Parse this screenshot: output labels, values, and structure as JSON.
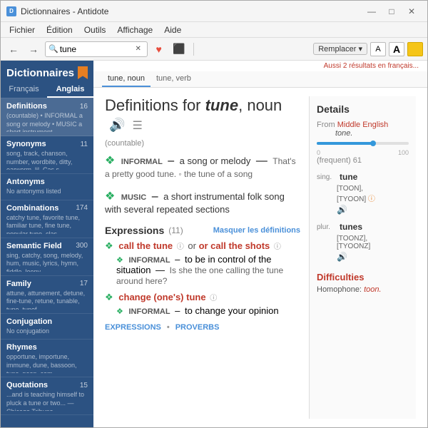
{
  "window": {
    "title": "Dictionnaires - Antidote",
    "icon_label": "D"
  },
  "menubar": {
    "items": [
      "Fichier",
      "Édition",
      "Outils",
      "Affichage",
      "Aide"
    ]
  },
  "toolbar": {
    "back_label": "←",
    "forward_label": "→",
    "search_value": "tune",
    "search_placeholder": "tune",
    "remplacer_label": "Remplacer ▾",
    "font_small_label": "A",
    "font_large_label": "A"
  },
  "also_results": "Aussi 2 résultats en français...",
  "sidebar": {
    "title": "Dictionnaires",
    "lang_tabs": [
      "Français",
      "Anglais"
    ],
    "active_lang": "Anglais",
    "sections": [
      {
        "id": "definitions",
        "title": "Definitions",
        "count": 16,
        "preview": "(countable) • INFORMAL a song or melody • MUSIC a short instrument..."
      },
      {
        "id": "synonyms",
        "title": "Synonyms",
        "count": 11,
        "preview": "song, track, chanson, number, wordbite, ditty, earworm, lil, Cas s..."
      },
      {
        "id": "antonyms",
        "title": "Antonyms",
        "count": "",
        "preview": "No antonyms listed"
      },
      {
        "id": "combinations",
        "title": "Combinations",
        "count": 174,
        "preview": "catchy tune, favorite tune, familiar tune, fine tune, popular tune, clas..."
      },
      {
        "id": "semantic",
        "title": "Semantic Field",
        "count": 300,
        "preview": "sing, catchy, song, melody, hum, music, lyrics, hymn, fiddle, loony..."
      },
      {
        "id": "family",
        "title": "Family",
        "count": 17,
        "preview": "attune, attunement, detune, fine-tune, retune, tunable, tune, tunef..."
      },
      {
        "id": "conjugation",
        "title": "Conjugation",
        "count": "",
        "preview": "No conjugation"
      },
      {
        "id": "rhymes",
        "title": "Rhymes",
        "count": "",
        "preview": "opportune, importune, immune, dune, bassoon, tune, peon, com..."
      },
      {
        "id": "quotations",
        "title": "Quotations",
        "count": 15,
        "preview": "...and is teaching himself to pluck a tune or two... — Chicago Tribune"
      }
    ]
  },
  "content": {
    "tabs": [
      {
        "id": "tune-noun",
        "label": "tune, noun"
      },
      {
        "id": "tune-verb",
        "label": "tune, verb"
      }
    ],
    "active_tab": "tune, noun",
    "definitions_heading": "Definitions for",
    "word": "tune",
    "pos": "noun",
    "countable_label": "(countable)",
    "definitions": [
      {
        "tag": "INFORMAL",
        "definition": "a song or melody",
        "example": "That's a pretty good tune. ◦ the tune of a song"
      },
      {
        "tag": "MUSIC",
        "definition": "a short instrumental folk song with several repeated sections",
        "example": ""
      }
    ],
    "expressions_heading": "Expressions",
    "expressions_count": "(11)",
    "masquer_label": "Masquer les définitions",
    "expressions": [
      {
        "phrase": "call the tune",
        "alt_phrase": "or call the shots",
        "tag": "INFORMAL",
        "definition": "to be in control of the situation",
        "example": "Is she the one calling the tune around here?"
      },
      {
        "phrase": "change (one's) tune",
        "tag": "INFORMAL",
        "definition": "to change your opinion",
        "example": ""
      }
    ],
    "bottom_links": [
      "EXPRESSIONS",
      "PROVERBS"
    ]
  },
  "details": {
    "title": "Details",
    "from_label": "From",
    "source": "Middle English",
    "source_word": "tone.",
    "freq_min": 0,
    "freq_max": 100,
    "freq_value": 61,
    "freq_label": "(frequent) 61",
    "sing_label": "sing.",
    "sing_word": "tune",
    "sing_ipa1": "[TOON],",
    "sing_ipa2": "[TYOON]",
    "plur_label": "plur.",
    "plur_word": "tunes",
    "plur_ipa1": "[TOONZ],",
    "plur_ipa2": "[TYOONZ]",
    "difficulties_title": "Difficulties",
    "homophone_label": "Homophone:",
    "homophone_word": "toon."
  },
  "win_controls": {
    "minimize": "—",
    "maximize": "□",
    "close": "✕"
  }
}
